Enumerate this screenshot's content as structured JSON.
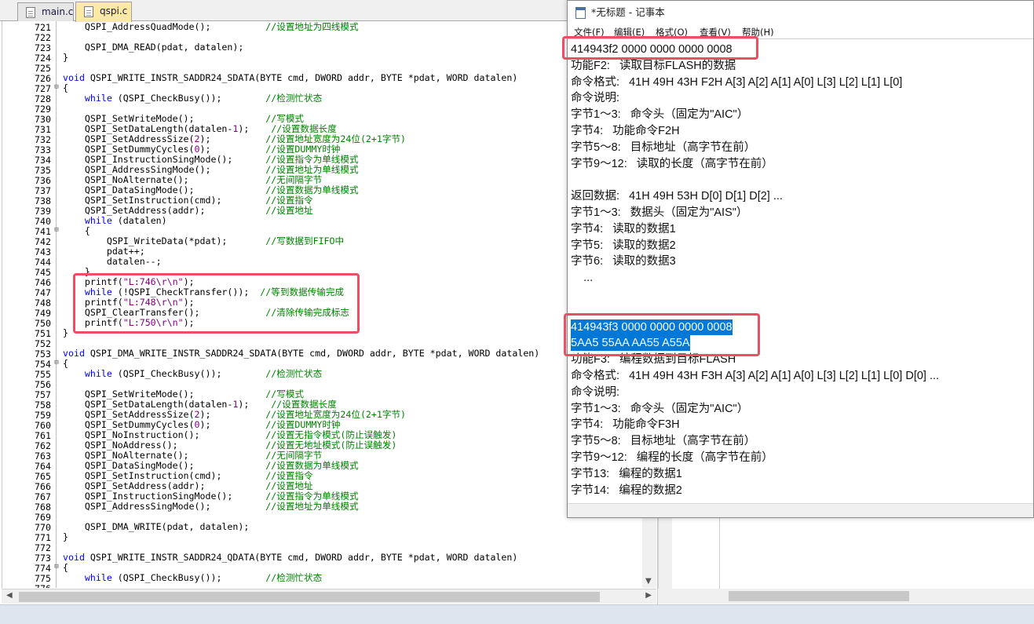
{
  "editor": {
    "tabs": [
      {
        "label": "main.c",
        "active": false
      },
      {
        "label": "qspi.c",
        "active": true
      }
    ],
    "lines": [
      {
        "n": "721",
        "fold": "",
        "parts": [
          [
            "t",
            "    QSPI_AddressQuadMode();          "
          ],
          [
            "cm",
            "//设置地址为四线模式"
          ]
        ]
      },
      {
        "n": "722",
        "fold": "",
        "parts": []
      },
      {
        "n": "723",
        "fold": "",
        "parts": [
          [
            "t",
            "    QSPI_DMA_READ(pdat, datalen);"
          ]
        ]
      },
      {
        "n": "724",
        "fold": "",
        "parts": [
          [
            "t",
            "}"
          ]
        ]
      },
      {
        "n": "725",
        "fold": "",
        "parts": []
      },
      {
        "n": "726",
        "fold": "",
        "parts": [
          [
            "kw",
            "void"
          ],
          [
            "t",
            " QSPI_WRITE_INSTR_SADDR24_SDATA(BYTE cmd, DWORD addr, BYTE *pdat, WORD datalen)"
          ]
        ]
      },
      {
        "n": "727",
        "fold": "⊟",
        "parts": [
          [
            "t",
            "{"
          ]
        ]
      },
      {
        "n": "728",
        "fold": "",
        "parts": [
          [
            "t",
            "    "
          ],
          [
            "kw",
            "while"
          ],
          [
            "t",
            " (QSPI_CheckBusy());        "
          ],
          [
            "cm",
            "//检测忙状态"
          ]
        ]
      },
      {
        "n": "729",
        "fold": "",
        "parts": []
      },
      {
        "n": "730",
        "fold": "",
        "parts": [
          [
            "t",
            "    QSPI_SetWriteMode();             "
          ],
          [
            "cm",
            "//写模式"
          ]
        ]
      },
      {
        "n": "731",
        "fold": "",
        "parts": [
          [
            "t",
            "    QSPI_SetDataLength(datalen-"
          ],
          [
            "nm",
            "1"
          ],
          [
            "t",
            ");    "
          ],
          [
            "cm",
            "//设置数据长度"
          ]
        ]
      },
      {
        "n": "732",
        "fold": "",
        "parts": [
          [
            "t",
            "    QSPI_SetAddressSize("
          ],
          [
            "nm",
            "2"
          ],
          [
            "t",
            ");          "
          ],
          [
            "cm",
            "//设置地址宽度为24位(2+1字节)"
          ]
        ]
      },
      {
        "n": "733",
        "fold": "",
        "parts": [
          [
            "t",
            "    QSPI_SetDummyCycles("
          ],
          [
            "nm",
            "0"
          ],
          [
            "t",
            ");          "
          ],
          [
            "cm",
            "//设置DUMMY时钟"
          ]
        ]
      },
      {
        "n": "734",
        "fold": "",
        "parts": [
          [
            "t",
            "    QSPI_InstructionSingMode();      "
          ],
          [
            "cm",
            "//设置指令为单线模式"
          ]
        ]
      },
      {
        "n": "735",
        "fold": "",
        "parts": [
          [
            "t",
            "    QSPI_AddressSingMode();          "
          ],
          [
            "cm",
            "//设置地址为单线模式"
          ]
        ]
      },
      {
        "n": "736",
        "fold": "",
        "parts": [
          [
            "t",
            "    QSPI_NoAlternate();              "
          ],
          [
            "cm",
            "//无间隔字节"
          ]
        ]
      },
      {
        "n": "737",
        "fold": "",
        "parts": [
          [
            "t",
            "    QSPI_DataSingMode();             "
          ],
          [
            "cm",
            "//设置数据为单线模式"
          ]
        ]
      },
      {
        "n": "738",
        "fold": "",
        "parts": [
          [
            "t",
            "    QSPI_SetInstruction(cmd);        "
          ],
          [
            "cm",
            "//设置指令"
          ]
        ]
      },
      {
        "n": "739",
        "fold": "",
        "parts": [
          [
            "t",
            "    QSPI_SetAddress(addr);           "
          ],
          [
            "cm",
            "//设置地址"
          ]
        ]
      },
      {
        "n": "740",
        "fold": "",
        "parts": [
          [
            "t",
            "    "
          ],
          [
            "kw",
            "while"
          ],
          [
            "t",
            " (datalen)"
          ]
        ]
      },
      {
        "n": "741",
        "fold": "⊟",
        "parts": [
          [
            "t",
            "    {"
          ]
        ]
      },
      {
        "n": "742",
        "fold": "",
        "parts": [
          [
            "t",
            "        QSPI_WriteData(*pdat);       "
          ],
          [
            "cm",
            "//写数据到FIFO中"
          ]
        ]
      },
      {
        "n": "743",
        "fold": "",
        "parts": [
          [
            "t",
            "        pdat++;"
          ]
        ]
      },
      {
        "n": "744",
        "fold": "",
        "parts": [
          [
            "t",
            "        datalen--;"
          ]
        ]
      },
      {
        "n": "745",
        "fold": "",
        "parts": [
          [
            "t",
            "    }"
          ]
        ]
      },
      {
        "n": "746",
        "fold": "",
        "parts": [
          [
            "t",
            "    printf("
          ],
          [
            "st",
            "\"L:746\\r\\n\""
          ],
          [
            "t",
            ");"
          ]
        ]
      },
      {
        "n": "747",
        "fold": "",
        "parts": [
          [
            "t",
            "    "
          ],
          [
            "kw",
            "while"
          ],
          [
            "t",
            " (!QSPI_CheckTransfer());  "
          ],
          [
            "cm",
            "//等到数据传输完成"
          ]
        ]
      },
      {
        "n": "748",
        "fold": "",
        "parts": [
          [
            "t",
            "    printf("
          ],
          [
            "st",
            "\"L:748\\r\\n\""
          ],
          [
            "t",
            ");"
          ]
        ]
      },
      {
        "n": "749",
        "fold": "",
        "parts": [
          [
            "t",
            "    QSPI_ClearTransfer();            "
          ],
          [
            "cm",
            "//清除传输完成标志"
          ]
        ]
      },
      {
        "n": "750",
        "fold": "",
        "parts": [
          [
            "t",
            "    printf("
          ],
          [
            "st",
            "\"L:750\\r\\n\""
          ],
          [
            "t",
            ");"
          ]
        ]
      },
      {
        "n": "751",
        "fold": "",
        "parts": [
          [
            "t",
            "}"
          ]
        ]
      },
      {
        "n": "752",
        "fold": "",
        "parts": []
      },
      {
        "n": "753",
        "fold": "",
        "parts": [
          [
            "kw",
            "void"
          ],
          [
            "t",
            " QSPI_DMA_WRITE_INSTR_SADDR24_SDATA(BYTE cmd, DWORD addr, BYTE *pdat, WORD datalen)"
          ]
        ]
      },
      {
        "n": "754",
        "fold": "⊟",
        "parts": [
          [
            "t",
            "{"
          ]
        ]
      },
      {
        "n": "755",
        "fold": "",
        "parts": [
          [
            "t",
            "    "
          ],
          [
            "kw",
            "while"
          ],
          [
            "t",
            " (QSPI_CheckBusy());        "
          ],
          [
            "cm",
            "//检测忙状态"
          ]
        ]
      },
      {
        "n": "756",
        "fold": "",
        "parts": []
      },
      {
        "n": "757",
        "fold": "",
        "parts": [
          [
            "t",
            "    QSPI_SetWriteMode();             "
          ],
          [
            "cm",
            "//写模式"
          ]
        ]
      },
      {
        "n": "758",
        "fold": "",
        "parts": [
          [
            "t",
            "    QSPI_SetDataLength(datalen-"
          ],
          [
            "nm",
            "1"
          ],
          [
            "t",
            ");    "
          ],
          [
            "cm",
            "//设置数据长度"
          ]
        ]
      },
      {
        "n": "759",
        "fold": "",
        "parts": [
          [
            "t",
            "    QSPI_SetAddressSize("
          ],
          [
            "nm",
            "2"
          ],
          [
            "t",
            ");          "
          ],
          [
            "cm",
            "//设置地址宽度为24位(2+1字节)"
          ]
        ]
      },
      {
        "n": "760",
        "fold": "",
        "parts": [
          [
            "t",
            "    QSPI_SetDummyCycles("
          ],
          [
            "nm",
            "0"
          ],
          [
            "t",
            ");          "
          ],
          [
            "cm",
            "//设置DUMMY时钟"
          ]
        ]
      },
      {
        "n": "761",
        "fold": "",
        "parts": [
          [
            "t",
            "    QSPI_NoInstruction();            "
          ],
          [
            "cm",
            "//设置无指令模式(防止误触发)"
          ]
        ]
      },
      {
        "n": "762",
        "fold": "",
        "parts": [
          [
            "t",
            "    QSPI_NoAddress();                "
          ],
          [
            "cm",
            "//设置无地址模式(防止误触发)"
          ]
        ]
      },
      {
        "n": "763",
        "fold": "",
        "parts": [
          [
            "t",
            "    QSPI_NoAlternate();              "
          ],
          [
            "cm",
            "//无间隔字节"
          ]
        ]
      },
      {
        "n": "764",
        "fold": "",
        "parts": [
          [
            "t",
            "    QSPI_DataSingMode();             "
          ],
          [
            "cm",
            "//设置数据为单线模式"
          ]
        ]
      },
      {
        "n": "765",
        "fold": "",
        "parts": [
          [
            "t",
            "    QSPI_SetInstruction(cmd);        "
          ],
          [
            "cm",
            "//设置指令"
          ]
        ]
      },
      {
        "n": "766",
        "fold": "",
        "parts": [
          [
            "t",
            "    QSPI_SetAddress(addr);           "
          ],
          [
            "cm",
            "//设置地址"
          ]
        ]
      },
      {
        "n": "767",
        "fold": "",
        "parts": [
          [
            "t",
            "    QSPI_InstructionSingMode();      "
          ],
          [
            "cm",
            "//设置指令为单线模式"
          ]
        ]
      },
      {
        "n": "768",
        "fold": "",
        "parts": [
          [
            "t",
            "    QSPI_AddressSingMode();          "
          ],
          [
            "cm",
            "//设置地址为单线模式"
          ]
        ]
      },
      {
        "n": "769",
        "fold": "",
        "parts": []
      },
      {
        "n": "770",
        "fold": "",
        "parts": [
          [
            "t",
            "    QSPI_DMA_WRITE(pdat, datalen);"
          ]
        ]
      },
      {
        "n": "771",
        "fold": "",
        "parts": [
          [
            "t",
            "}"
          ]
        ]
      },
      {
        "n": "772",
        "fold": "",
        "parts": []
      },
      {
        "n": "773",
        "fold": "",
        "parts": [
          [
            "kw",
            "void"
          ],
          [
            "t",
            " QSPI_WRITE_INSTR_SADDR24_QDATA(BYTE cmd, DWORD addr, BYTE *pdat, WORD datalen)"
          ]
        ]
      },
      {
        "n": "774",
        "fold": "⊟",
        "parts": [
          [
            "t",
            "{"
          ]
        ]
      },
      {
        "n": "775",
        "fold": "",
        "parts": [
          [
            "t",
            "    "
          ],
          [
            "kw",
            "while"
          ],
          [
            "t",
            " (QSPI_CheckBusy());        "
          ],
          [
            "cm",
            "//检测忙状态"
          ]
        ]
      },
      {
        "n": "776",
        "fold": "",
        "parts": []
      }
    ]
  },
  "notepad": {
    "title": "*无标题 - 记事本",
    "menu": [
      "文件(F)",
      "编辑(E)",
      "格式(O)",
      "查看(V)",
      "帮助(H)"
    ],
    "lines": [
      {
        "text": "414943f2 0000 0000 0000 0008",
        "selected": false
      },
      {
        "text": "功能F2:   读取目标FLASH的数据",
        "selected": false
      },
      {
        "text": "命令格式:   41H 49H 43H F2H A[3] A[2] A[1] A[0] L[3] L[2] L[1] L[0]",
        "selected": false
      },
      {
        "text": "命令说明:",
        "selected": false
      },
      {
        "text": "字节1～3:   命令头（固定为\"AIC\"）",
        "selected": false
      },
      {
        "text": "字节4:   功能命令F2H",
        "selected": false
      },
      {
        "text": "字节5～8:   目标地址（高字节在前）",
        "selected": false
      },
      {
        "text": "字节9～12:   读取的长度（高字节在前）",
        "selected": false
      },
      {
        "text": "",
        "selected": false
      },
      {
        "text": "返回数据:   41H 49H 53H D[0] D[1] D[2] ...",
        "selected": false
      },
      {
        "text": "字节1～3:   数据头（固定为\"AIS\"）",
        "selected": false
      },
      {
        "text": "字节4:   读取的数据1",
        "selected": false
      },
      {
        "text": "字节5:   读取的数据2",
        "selected": false
      },
      {
        "text": "字节6:   读取的数据3",
        "selected": false
      },
      {
        "text": "    ...",
        "selected": false
      },
      {
        "text": "",
        "selected": false
      },
      {
        "text": "",
        "selected": false
      },
      {
        "text": "414943f3 0000 0000 0000 0008",
        "selected": true
      },
      {
        "text": "5AA5 55AA AA55 A55A",
        "selected": true
      },
      {
        "text": "功能F3:   编程数据到目标FLASH",
        "selected": false
      },
      {
        "text": "命令格式:   41H 49H 43H F3H A[3] A[2] A[1] A[0] L[3] L[2] L[1] L[0] D[0] ...",
        "selected": false
      },
      {
        "text": "命令说明:",
        "selected": false
      },
      {
        "text": "字节1～3:   命令头（固定为\"AIC\"）",
        "selected": false
      },
      {
        "text": "字节4:   功能命令F3H",
        "selected": false
      },
      {
        "text": "字节5～8:   目标地址（高字节在前）",
        "selected": false
      },
      {
        "text": "字节9～12:   编程的长度（高字节在前）",
        "selected": false
      },
      {
        "text": "字节13:   编程的数据1",
        "selected": false
      },
      {
        "text": "字节14:   编程的数据2",
        "selected": false
      }
    ]
  },
  "colors": {
    "highlight_box": "#ec4e63",
    "selection": "#0078d7",
    "keyword": "#0000ff",
    "comment": "#008000",
    "active_tab": "#fbe9a4"
  }
}
